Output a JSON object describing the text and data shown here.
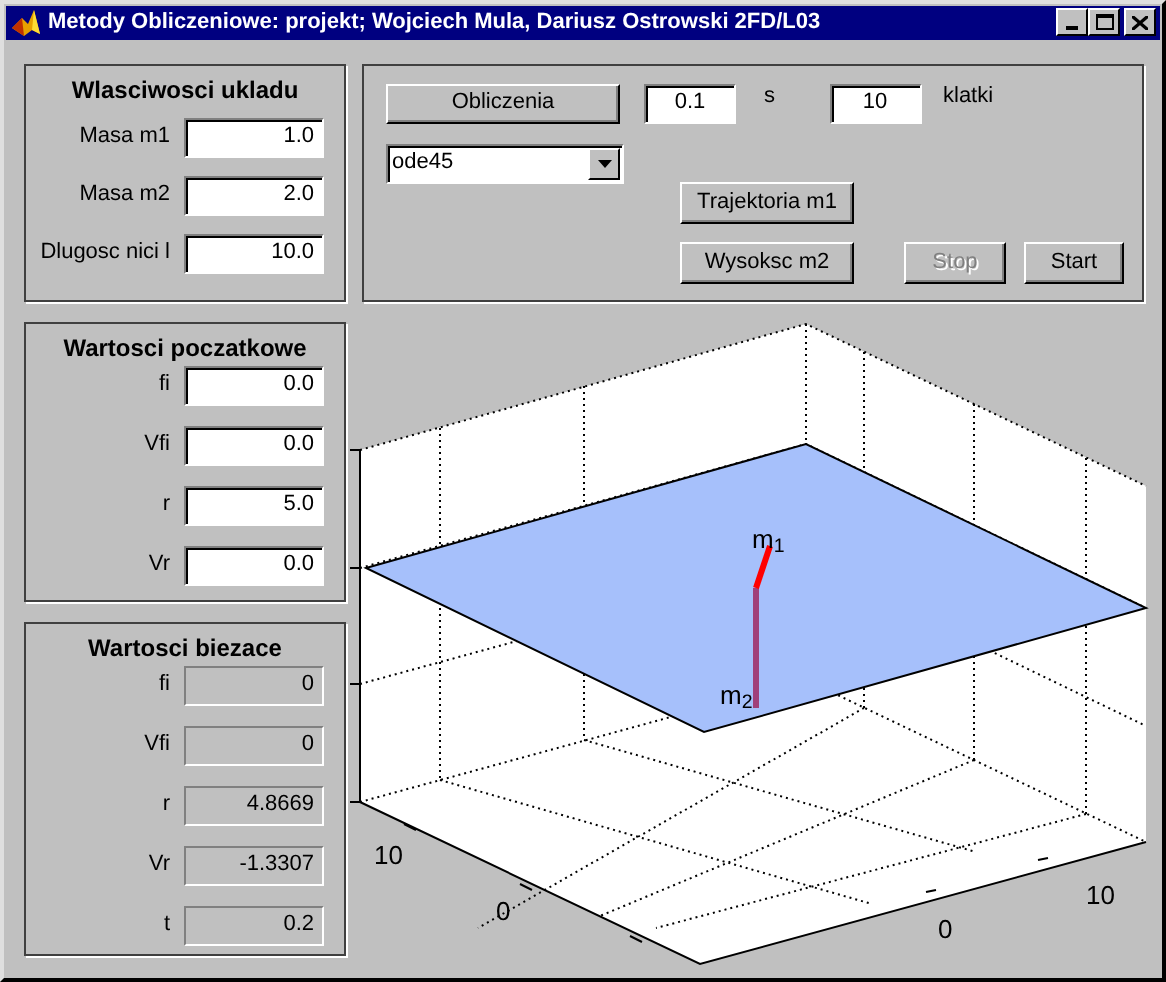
{
  "window": {
    "title": "Metody Obliczeniowe: projekt; Wojciech Mula, Dariusz Ostrowski 2FD/L03"
  },
  "panels": [
    {
      "kind": "input",
      "title": "Wlasciwosci ukladu",
      "fields": [
        {
          "label": "Masa m1",
          "value": "1.0"
        },
        {
          "label": "Masa m2",
          "value": "2.0"
        },
        {
          "label": "Dlugosc nici l",
          "value": "10.0"
        }
      ]
    },
    {
      "kind": "input",
      "title": "Wartosci poczatkowe",
      "fields": [
        {
          "label": "fi",
          "value": "0.0"
        },
        {
          "label": "Vfi",
          "value": "0.0"
        },
        {
          "label": "r",
          "value": "5.0"
        },
        {
          "label": "Vr",
          "value": "0.0"
        }
      ]
    },
    {
      "kind": "readout",
      "title": "Wartosci biezace",
      "fields": [
        {
          "label": "fi",
          "value": "0"
        },
        {
          "label": "Vfi",
          "value": "0"
        },
        {
          "label": "r",
          "value": "4.8669"
        },
        {
          "label": "Vr",
          "value": "-1.3307"
        },
        {
          "label": "t",
          "value": "0.2"
        }
      ]
    }
  ],
  "controls": {
    "compute_button": "Obliczenia",
    "time_step": {
      "value": "0.1",
      "unit": "s"
    },
    "frames": {
      "value": "10",
      "unit": "klatki"
    },
    "solver": {
      "value": "ode45"
    },
    "buttons": [
      {
        "label": "Trajektoria m1",
        "disabled": false
      },
      {
        "label": "Wysoksc m2",
        "disabled": false
      },
      {
        "label": "Stop",
        "disabled": true
      },
      {
        "label": "Start",
        "disabled": false
      }
    ]
  },
  "plot": {
    "mass_labels": [
      "m$_{1}$",
      "m$_{2}$"
    ],
    "tick_labels": [
      "10",
      "0",
      "0",
      "10"
    ]
  }
}
